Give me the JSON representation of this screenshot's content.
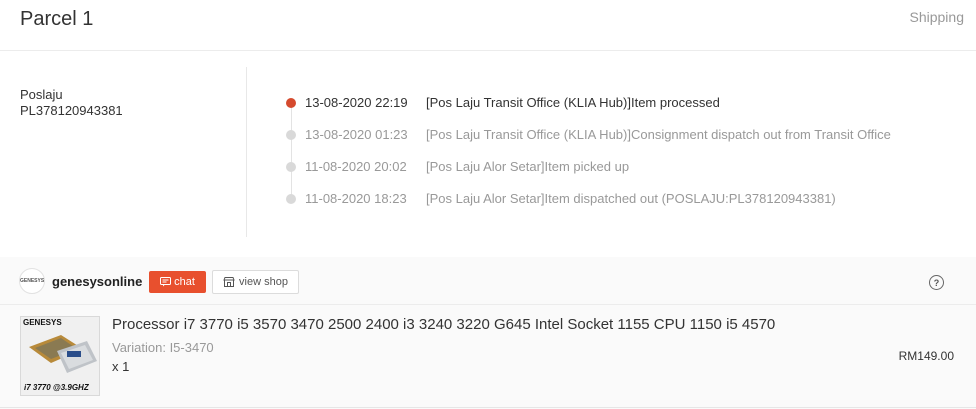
{
  "header": {
    "title": "Parcel 1",
    "status": "Shipping"
  },
  "courier": {
    "name": "Poslaju",
    "tracking_number": "PL378120943381"
  },
  "timeline": [
    {
      "time": "13-08-2020 22:19",
      "description": "[Pos Laju Transit Office (KLIA Hub)]Item processed"
    },
    {
      "time": "13-08-2020 01:23",
      "description": "[Pos Laju Transit Office (KLIA Hub)]Consignment dispatch out from Transit Office"
    },
    {
      "time": "11-08-2020 20:02",
      "description": "[Pos Laju Alor Setar]Item picked up"
    },
    {
      "time": "11-08-2020 18:23",
      "description": "[Pos Laju Alor Setar]Item dispatched out (POSLAJU:PL378120943381)"
    }
  ],
  "shop": {
    "logo_text": "GENESYS",
    "name": "genesysonline",
    "chat_label": "chat",
    "view_shop_label": "view shop",
    "help_icon": "?"
  },
  "product": {
    "image_brand": "GENESYS",
    "image_spec": "i7 3770 @3.9GHZ",
    "title": "Processor i7 3770 i5 3570 3470 2500 2400 i3 3240 3220 G645 Intel Socket 1155 CPU 1150 i5 4570",
    "variation": "Variation: I5-3470",
    "quantity": "x 1",
    "price": "RM149.00"
  },
  "colors": {
    "accent": "#e8502e",
    "active_dot": "#d54a2e",
    "muted_text": "#999999"
  }
}
